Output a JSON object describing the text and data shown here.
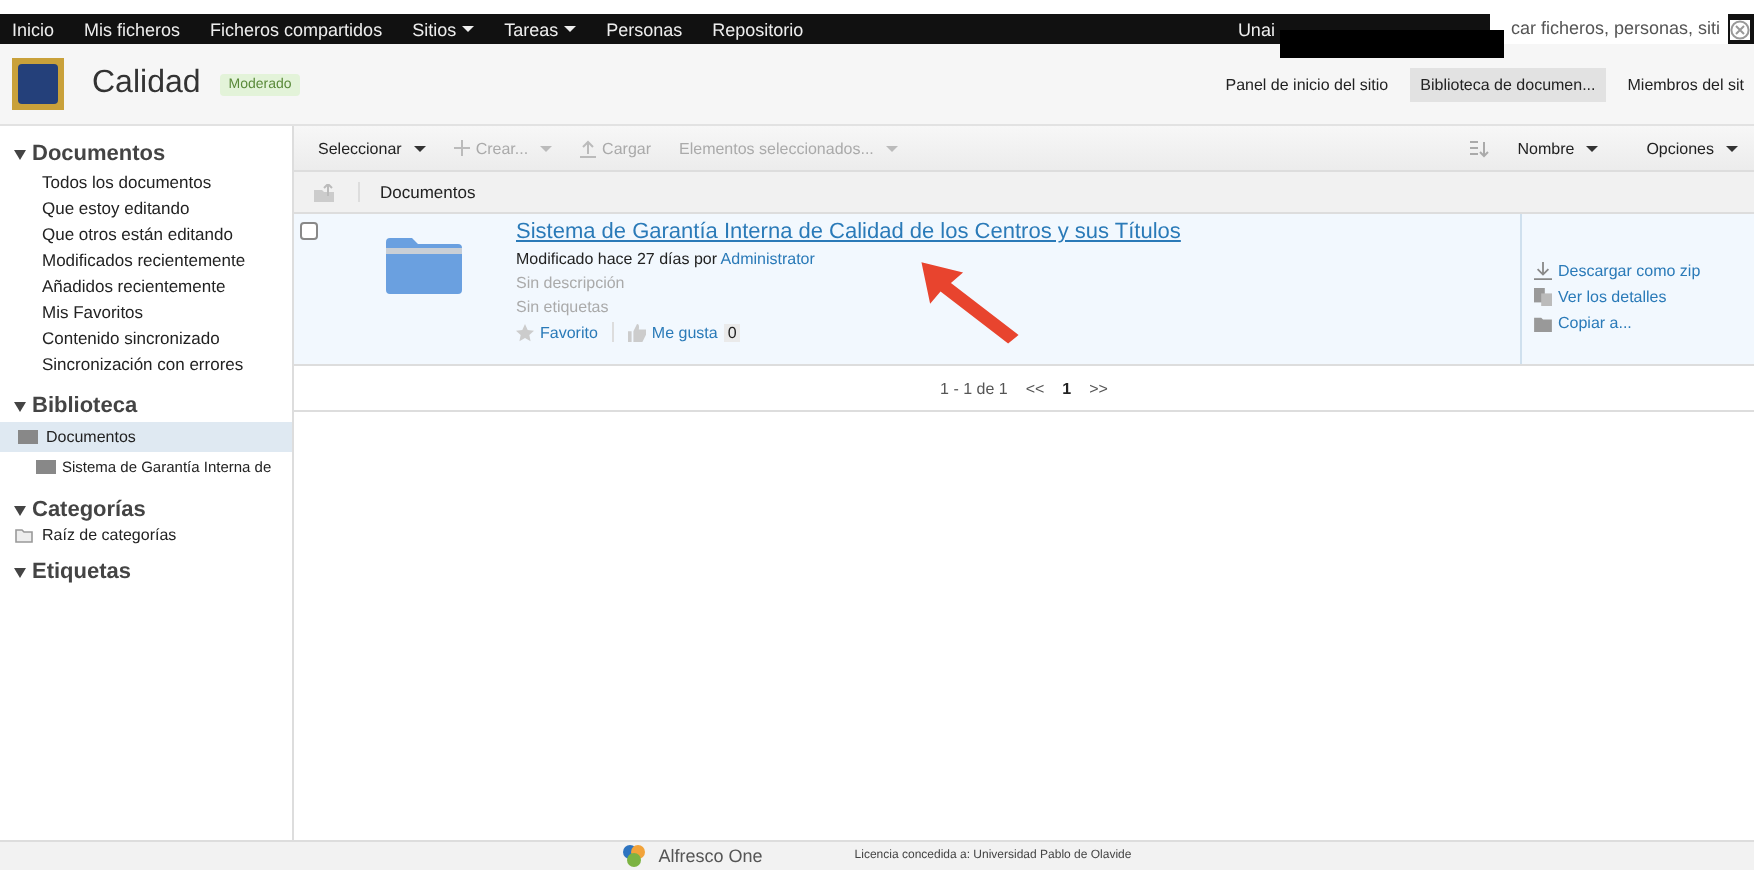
{
  "top_nav": {
    "items": [
      {
        "label": "Inicio",
        "dropdown": false
      },
      {
        "label": "Mis ficheros",
        "dropdown": false
      },
      {
        "label": "Ficheros compartidos",
        "dropdown": false
      },
      {
        "label": "Sitios",
        "dropdown": true
      },
      {
        "label": "Tareas",
        "dropdown": true
      },
      {
        "label": "Personas",
        "dropdown": false
      },
      {
        "label": "Repositorio",
        "dropdown": false
      }
    ],
    "user": "Unai",
    "search": {
      "value": "car ficheros, personas, siti"
    }
  },
  "site_header": {
    "title": "Calidad",
    "badge": "Moderado",
    "links": [
      {
        "label": "Panel de inicio del sitio",
        "selected": false
      },
      {
        "label": "Biblioteca de documen...",
        "selected": true
      },
      {
        "label": "Miembros del sit",
        "selected": false
      }
    ]
  },
  "sidebar": {
    "sections": [
      {
        "title": "Documentos",
        "expanded": true,
        "kind": "list",
        "items": [
          {
            "label": "Todos los documentos"
          },
          {
            "label": "Que estoy editando"
          },
          {
            "label": "Que otros están editando"
          },
          {
            "label": "Modificados recientemente"
          },
          {
            "label": "Añadidos recientemente"
          },
          {
            "label": "Mis Favoritos"
          },
          {
            "label": "Contenido sincronizado"
          },
          {
            "label": "Sincronización con errores"
          }
        ]
      },
      {
        "title": "Biblioteca",
        "expanded": true,
        "kind": "tree",
        "items": [
          {
            "label": "Documentos",
            "selected": true,
            "children": [
              {
                "label": "Sistema de Garantía Interna de",
                "selected": false
              }
            ]
          }
        ]
      },
      {
        "title": "Categorías",
        "expanded": true,
        "kind": "category",
        "items": [
          {
            "label": "Raíz de categorías"
          }
        ]
      },
      {
        "title": "Etiquetas",
        "expanded": true
      }
    ]
  },
  "toolbar": {
    "buttons": [
      {
        "label": "Seleccionar",
        "kind": "menu",
        "disabled": false
      },
      {
        "label": "Crear...",
        "kind": "create",
        "disabled": true
      },
      {
        "label": "Cargar",
        "kind": "upload",
        "disabled": true
      },
      {
        "label": "Elementos seleccionados...",
        "kind": "menu",
        "disabled": true
      }
    ],
    "sort": "Nombre",
    "options": "Opciones"
  },
  "breadcrumb": "Documentos",
  "items": [
    {
      "checked": false,
      "title": "Sistema de Garantía Interna de Calidad de los Centros y sus Títulos",
      "modified": "Modificado hace 27 días por",
      "author": "Administrator",
      "description": "Sin descripción",
      "tags": "Sin etiquetas",
      "favorite": "Favorito",
      "like": "Me gusta",
      "likes": "0",
      "actions": [
        {
          "label": "Descargar como zip",
          "kind": "download"
        },
        {
          "label": "Ver los detalles",
          "kind": "details"
        },
        {
          "label": "Copiar a...",
          "kind": "copy"
        }
      ]
    }
  ],
  "pagination": {
    "summary": "1 - 1 de 1",
    "prev": "<<",
    "page": "1",
    "next": ">>"
  },
  "footer": {
    "logo": "Alfresco One",
    "license": "Licencia concedida a: Universidad Pablo de Olavide"
  }
}
